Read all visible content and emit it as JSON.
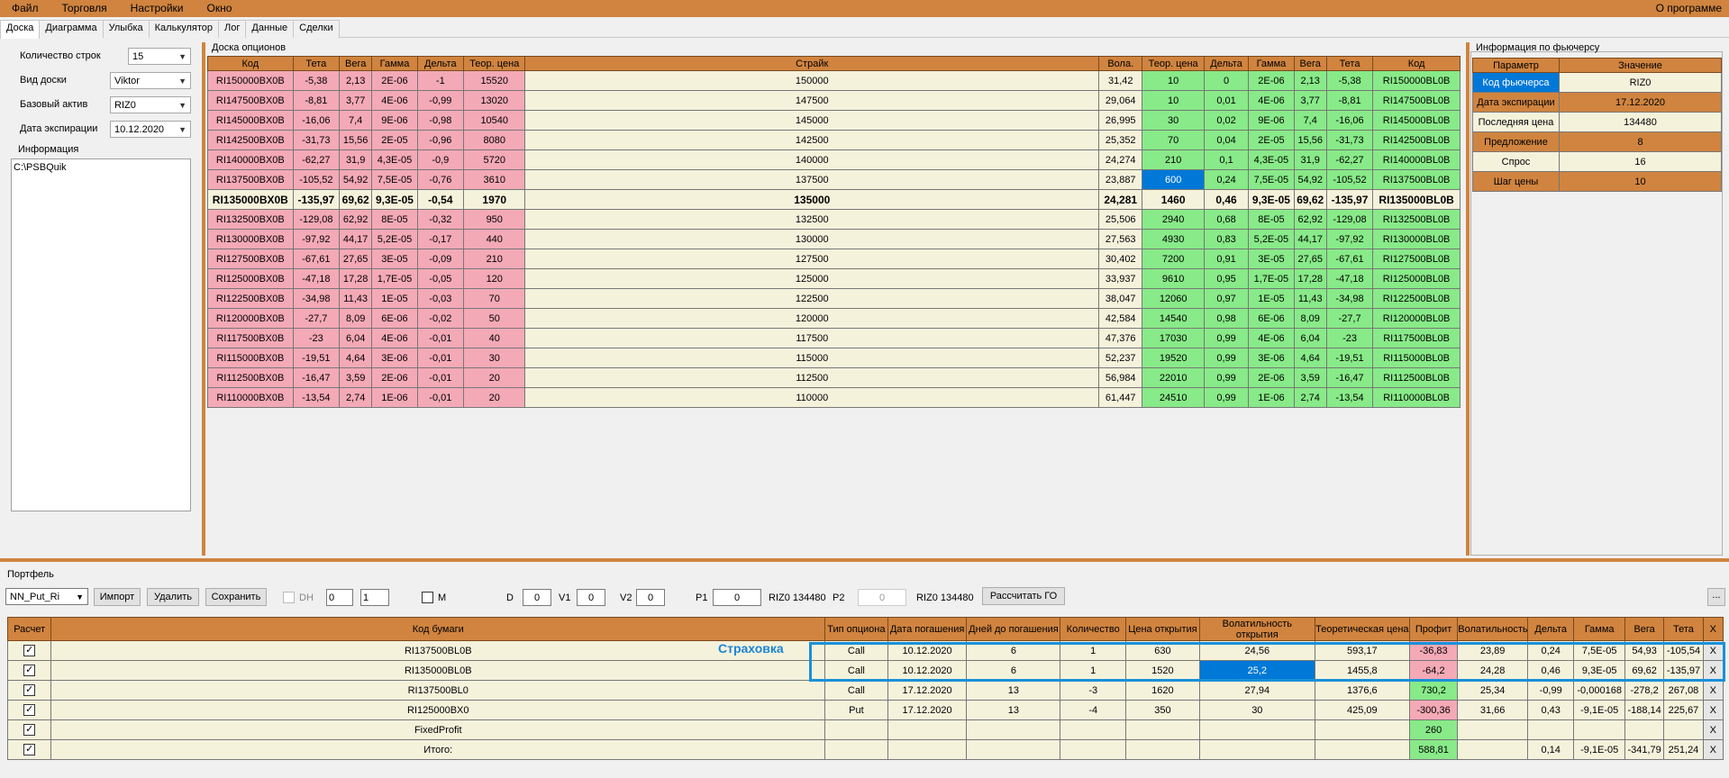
{
  "menu": {
    "file": "Файл",
    "trade": "Торговля",
    "settings": "Настройки",
    "window": "Окно",
    "about": "О программе"
  },
  "tabs": [
    "Доска",
    "Диаграмма",
    "Улыбка",
    "Калькулятор",
    "Лог",
    "Данные",
    "Сделки"
  ],
  "left": {
    "rows_label": "Количество строк",
    "rows_value": "15",
    "view_label": "Вид доски",
    "view_value": "Viktor",
    "base_label": "Базовый актив",
    "base_value": "RIZ0",
    "exp_label": "Дата экспирации",
    "exp_value": "10.12.2020",
    "info_label": "Информация",
    "info_text": "C:\\PSBQuik"
  },
  "board": {
    "title": "Доска опционов",
    "headers": [
      "Код",
      "Тета",
      "Вега",
      "Гамма",
      "Дельта",
      "Теор. цена",
      "Страйк",
      "Вола.",
      "Теор. цена",
      "Дельта",
      "Гамма",
      "Вега",
      "Тета",
      "Код"
    ],
    "rows": [
      [
        "RI150000BX0B",
        "-5,38",
        "2,13",
        "2E-06",
        "-1",
        "15520",
        "150000",
        "31,42",
        "10",
        "0",
        "2E-06",
        "2,13",
        "-5,38",
        "RI150000BL0B"
      ],
      [
        "RI147500BX0B",
        "-8,81",
        "3,77",
        "4E-06",
        "-0,99",
        "13020",
        "147500",
        "29,064",
        "10",
        "0,01",
        "4E-06",
        "3,77",
        "-8,81",
        "RI147500BL0B"
      ],
      [
        "RI145000BX0B",
        "-16,06",
        "7,4",
        "9E-06",
        "-0,98",
        "10540",
        "145000",
        "26,995",
        "30",
        "0,02",
        "9E-06",
        "7,4",
        "-16,06",
        "RI145000BL0B"
      ],
      [
        "RI142500BX0B",
        "-31,73",
        "15,56",
        "2E-05",
        "-0,96",
        "8080",
        "142500",
        "25,352",
        "70",
        "0,04",
        "2E-05",
        "15,56",
        "-31,73",
        "RI142500BL0B"
      ],
      [
        "RI140000BX0B",
        "-62,27",
        "31,9",
        "4,3E-05",
        "-0,9",
        "5720",
        "140000",
        "24,274",
        "210",
        "0,1",
        "4,3E-05",
        "31,9",
        "-62,27",
        "RI140000BL0B"
      ],
      [
        "RI137500BX0B",
        "-105,52",
        "54,92",
        "7,5E-05",
        "-0,76",
        "3610",
        "137500",
        "23,887",
        "600",
        "0,24",
        "7,5E-05",
        "54,92",
        "-105,52",
        "RI137500BL0B"
      ],
      [
        "RI135000BX0B",
        "-135,97",
        "69,62",
        "9,3E-05",
        "-0,54",
        "1970",
        "135000",
        "24,281",
        "1460",
        "0,46",
        "9,3E-05",
        "69,62",
        "-135,97",
        "RI135000BL0B"
      ],
      [
        "RI132500BX0B",
        "-129,08",
        "62,92",
        "8E-05",
        "-0,32",
        "950",
        "132500",
        "25,506",
        "2940",
        "0,68",
        "8E-05",
        "62,92",
        "-129,08",
        "RI132500BL0B"
      ],
      [
        "RI130000BX0B",
        "-97,92",
        "44,17",
        "5,2E-05",
        "-0,17",
        "440",
        "130000",
        "27,563",
        "4930",
        "0,83",
        "5,2E-05",
        "44,17",
        "-97,92",
        "RI130000BL0B"
      ],
      [
        "RI127500BX0B",
        "-67,61",
        "27,65",
        "3E-05",
        "-0,09",
        "210",
        "127500",
        "30,402",
        "7200",
        "0,91",
        "3E-05",
        "27,65",
        "-67,61",
        "RI127500BL0B"
      ],
      [
        "RI125000BX0B",
        "-47,18",
        "17,28",
        "1,7E-05",
        "-0,05",
        "120",
        "125000",
        "33,937",
        "9610",
        "0,95",
        "1,7E-05",
        "17,28",
        "-47,18",
        "RI125000BL0B"
      ],
      [
        "RI122500BX0B",
        "-34,98",
        "11,43",
        "1E-05",
        "-0,03",
        "70",
        "122500",
        "38,047",
        "12060",
        "0,97",
        "1E-05",
        "11,43",
        "-34,98",
        "RI122500BL0B"
      ],
      [
        "RI120000BX0B",
        "-27,7",
        "8,09",
        "6E-06",
        "-0,02",
        "50",
        "120000",
        "42,584",
        "14540",
        "0,98",
        "6E-06",
        "8,09",
        "-27,7",
        "RI120000BL0B"
      ],
      [
        "RI117500BX0B",
        "-23",
        "6,04",
        "4E-06",
        "-0,01",
        "40",
        "117500",
        "47,376",
        "17030",
        "0,99",
        "4E-06",
        "6,04",
        "-23",
        "RI117500BL0B"
      ],
      [
        "RI115000BX0B",
        "-19,51",
        "4,64",
        "3E-06",
        "-0,01",
        "30",
        "115000",
        "52,237",
        "19520",
        "0,99",
        "3E-06",
        "4,64",
        "-19,51",
        "RI115000BL0B"
      ],
      [
        "RI112500BX0B",
        "-16,47",
        "3,59",
        "2E-06",
        "-0,01",
        "20",
        "112500",
        "56,984",
        "22010",
        "0,99",
        "2E-06",
        "3,59",
        "-16,47",
        "RI112500BL0B"
      ],
      [
        "RI110000BX0B",
        "-13,54",
        "2,74",
        "1E-06",
        "-0,01",
        "20",
        "110000",
        "61,447",
        "24510",
        "0,99",
        "1E-06",
        "2,74",
        "-13,54",
        "RI110000BL0B"
      ]
    ]
  },
  "futures": {
    "title": "Информация по фьючерсу",
    "headers": [
      "Параметр",
      "Значение"
    ],
    "rows": [
      [
        "Код фьючерса",
        "RIZ0"
      ],
      [
        "Дата экспирации",
        "17.12.2020"
      ],
      [
        "Последняя цена",
        "134480"
      ],
      [
        "Предложение",
        "8"
      ],
      [
        "Спрос",
        "16"
      ],
      [
        "Шаг цены",
        "10"
      ]
    ]
  },
  "portfolio": {
    "label": "Портфель",
    "name": "NN_Put_Ri",
    "import": "Импорт",
    "delete": "Удалить",
    "save": "Сохранить",
    "dh": "DH",
    "dh_v1": "0",
    "dh_v2": "1",
    "m": "M",
    "d_label": "D",
    "d_value": "0",
    "v1_label": "V1",
    "v1_value": "0",
    "v2_label": "V2",
    "v2_value": "0",
    "p1_label": "P1",
    "p1_value": "0",
    "p1_info": "RIZ0 134480",
    "p2_label": "P2",
    "p2_value": "0",
    "p2_info": "RIZ0 134480",
    "calc_go": "Рассчитать ГО",
    "dots": "...",
    "insurance": "Страховка",
    "headers": [
      "Расчет",
      "Код бумаги",
      "Тип опциона",
      "Дата погашения",
      "Дней до погашения",
      "Количество",
      "Цена открытия",
      "Волатильность открытия",
      "Теоретическая цена",
      "Профит",
      "Волатильность",
      "Дельта",
      "Гамма",
      "Вега",
      "Тета",
      "X"
    ],
    "rows": [
      [
        "✓",
        "RI137500BL0B",
        "Call",
        "10.12.2020",
        "6",
        "1",
        "630",
        "24,56",
        "593,17",
        "-36,83",
        "23,89",
        "0,24",
        "7,5E-05",
        "54,93",
        "-105,54",
        "X"
      ],
      [
        "✓",
        "RI135000BL0B",
        "Call",
        "10.12.2020",
        "6",
        "1",
        "1520",
        "25,2",
        "1455,8",
        "-64,2",
        "24,28",
        "0,46",
        "9,3E-05",
        "69,62",
        "-135,97",
        "X"
      ],
      [
        "✓",
        "RI137500BL0",
        "Call",
        "17.12.2020",
        "13",
        "-3",
        "1620",
        "27,94",
        "1376,6",
        "730,2",
        "25,34",
        "-0,99",
        "-0,000168",
        "-278,2",
        "267,08",
        "X"
      ],
      [
        "✓",
        "RI125000BX0",
        "Put",
        "17.12.2020",
        "13",
        "-4",
        "350",
        "30",
        "425,09",
        "-300,36",
        "31,66",
        "0,43",
        "-9,1E-05",
        "-188,14",
        "225,67",
        "X"
      ],
      [
        "✓",
        "FixedProfit",
        "",
        "",
        "",
        "",
        "",
        "",
        "",
        "260",
        "",
        "",
        "",
        "",
        "",
        "X"
      ],
      [
        "✓",
        "Итого:",
        "",
        "",
        "",
        "",
        "",
        "",
        "",
        "588,81",
        "",
        "0,14",
        "-9,1E-05",
        "-341,79",
        "251,24",
        "X"
      ]
    ]
  }
}
